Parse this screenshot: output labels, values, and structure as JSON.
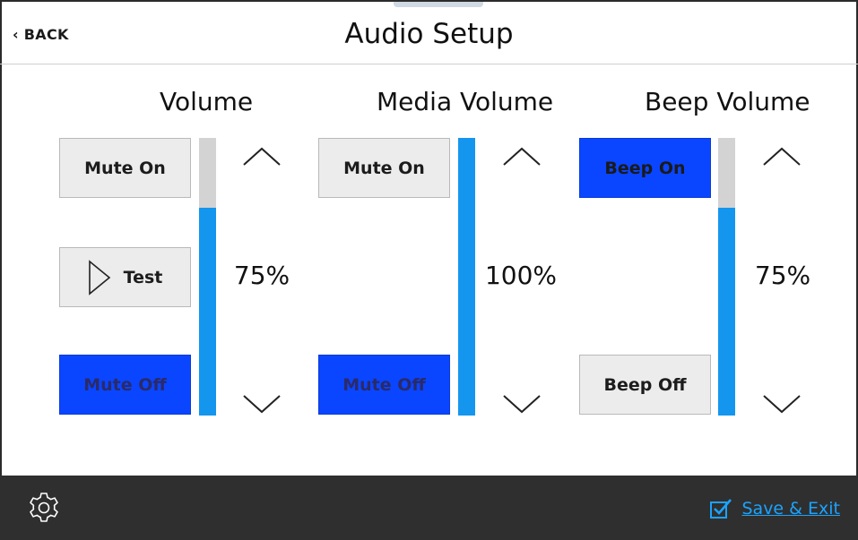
{
  "header": {
    "back_label": "BACK",
    "title": "Audio Setup"
  },
  "volume": {
    "title": "Volume",
    "mute_on_label": "Mute On",
    "test_label": "Test",
    "mute_off_label": "Mute Off",
    "level_text": "75%",
    "level": 0.75
  },
  "media_volume": {
    "title": "Media Volume",
    "mute_on_label": "Mute On",
    "mute_off_label": "Mute Off",
    "level_text": "100%",
    "level": 1.0
  },
  "beep_volume": {
    "title": "Beep Volume",
    "beep_on_label": "Beep On",
    "beep_off_label": "Beep Off",
    "level_text": "75%",
    "level": 0.75
  },
  "footer": {
    "save_label": "Save & Exit",
    "settings_icon": "gear-icon",
    "checkbox_icon": "checkbox-checked-icon"
  },
  "colors": {
    "active_button": "#0a46ff",
    "slider_fill": "#1496ef",
    "slider_track": "#d3d3d3",
    "footer_bg": "#2f2f2f",
    "link": "#1ba3ff"
  }
}
